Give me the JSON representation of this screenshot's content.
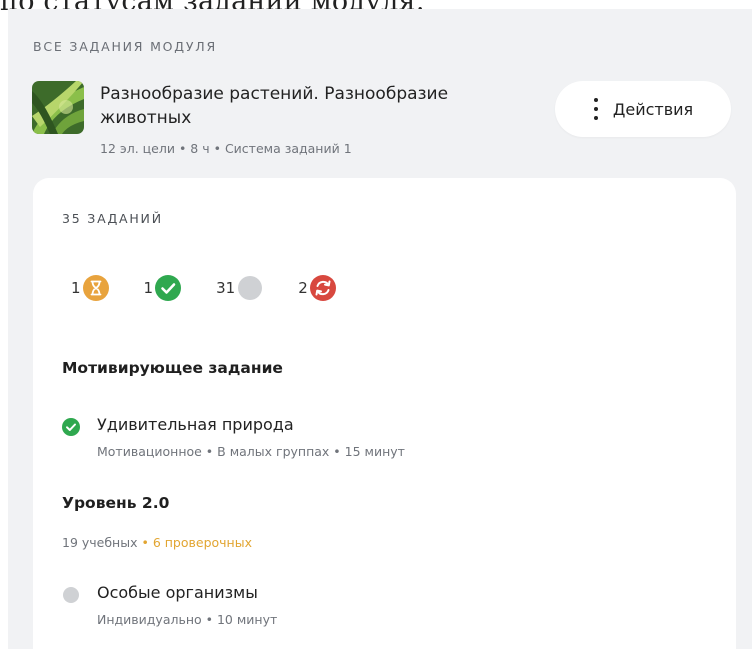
{
  "caption_fragment": "по статусам заданий модуля.",
  "header": {
    "section_label": "ВСЕ ЗАДАНИЯ МОДУЛЯ",
    "module_title": "Разнообразие растений. Разнообразие животных",
    "module_meta": "12 эл. цели • 8 ч • Система заданий 1",
    "actions_label": "Действия"
  },
  "card": {
    "tasks_count": "35 ЗАДАНИЙ",
    "status_summary": [
      {
        "count": "1",
        "status": "in-progress",
        "icon": "hourglass-icon",
        "color": "#e8a33d"
      },
      {
        "count": "1",
        "status": "completed",
        "icon": "check-icon",
        "color": "#2fa84f"
      },
      {
        "count": "31",
        "status": "not-started",
        "icon": "grey-circle-icon",
        "color": "#cfd1d4"
      },
      {
        "count": "2",
        "status": "needs-retry",
        "icon": "refresh-icon",
        "color": "#d8483f"
      }
    ],
    "groups": [
      {
        "title": "Мотивирующее задание",
        "tasks": [
          {
            "name": "Удивительная природа",
            "meta": "Мотивационное • В малых группах • 15 минут",
            "status": "completed"
          }
        ]
      },
      {
        "title": "Уровень 2.0",
        "stats_normal": "19 учебных",
        "stats_accent": " • 6 проверочных",
        "tasks": [
          {
            "name": "Особые организмы",
            "meta": "Индивидуально • 10 минут",
            "status": "not-started"
          }
        ]
      }
    ]
  },
  "colors": {
    "accent_yellow": "#e2a531",
    "success_green": "#2fa84f",
    "error_red": "#d8483f",
    "neutral_grey": "#cfd1d4",
    "panel_background": "#f1f2f4"
  }
}
